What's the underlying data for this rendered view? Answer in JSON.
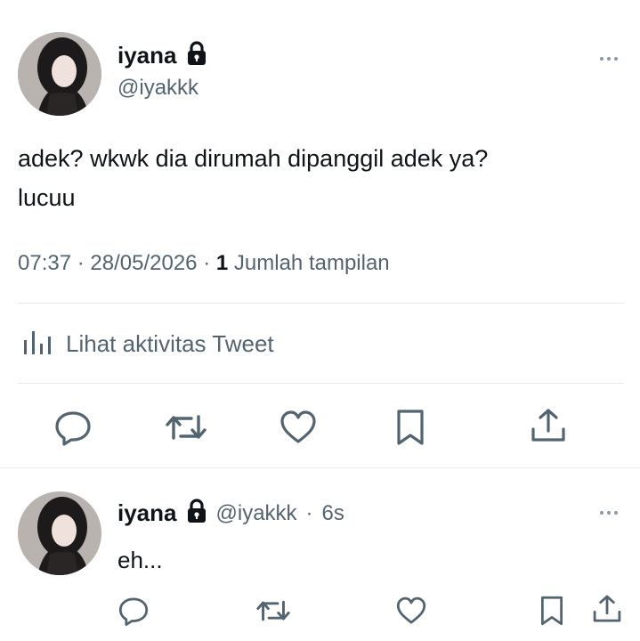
{
  "main_tweet": {
    "display_name": "iyana",
    "handle": "@iyakkk",
    "text_line1": "adek? wkwk dia dirumah dipanggil adek ya?",
    "text_line2": "lucuu",
    "time": "07:37",
    "date": "28/05/2026",
    "separator": "·",
    "views_count": "1",
    "views_label": "Jumlah tampilan",
    "activity_label": "Lihat aktivitas Tweet"
  },
  "reply_tweet": {
    "display_name": "iyana",
    "handle": "@iyakkk",
    "age": "6s",
    "separator": "·",
    "text": "eh..."
  },
  "colors": {
    "text_primary": "#0f1419",
    "text_secondary": "#536471",
    "icon": "#536471",
    "divider": "#e6e9ec"
  },
  "icons": [
    "lock-icon",
    "more-icon",
    "activity-icon",
    "reply-icon",
    "retweet-icon",
    "like-icon",
    "bookmark-icon",
    "share-icon"
  ]
}
